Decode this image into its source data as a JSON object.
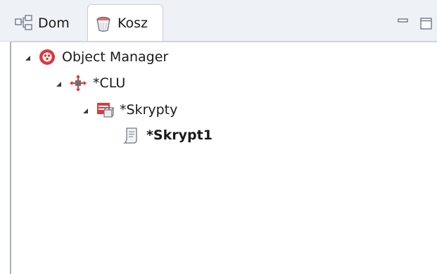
{
  "tabs": [
    {
      "label": "Dom",
      "icon": "network-icon"
    },
    {
      "label": "Kosz",
      "icon": "trash-bin-icon",
      "active": true
    }
  ],
  "window_controls": {
    "minimize_icon": "minimize-icon",
    "maximize_icon": "maximize-icon"
  },
  "tree": {
    "root": {
      "label": "Object Manager",
      "expanded": true,
      "icon": "object-manager-icon"
    },
    "clu": {
      "label": "*CLU",
      "expanded": true,
      "icon": "clu-icon"
    },
    "scripts": {
      "label": "*Skrypty",
      "expanded": true,
      "icon": "scripts-folder-icon"
    },
    "script1": {
      "label": "*Skrypt1",
      "icon": "script-file-icon"
    }
  },
  "colors": {
    "tab_bar": "#eef1f6",
    "object_manager": "#d93a3a",
    "clu": "#e23030",
    "scripts": "#d83c3c"
  }
}
